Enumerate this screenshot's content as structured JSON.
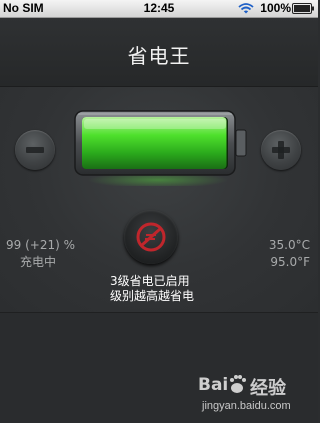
{
  "status_bar": {
    "carrier": "No SIM",
    "time": "12:45",
    "battery_percent": "100%",
    "wifi_icon": "wifi-icon",
    "battery_icon": "battery-full-icon"
  },
  "header": {
    "title": "省电王"
  },
  "battery": {
    "level": 0.99,
    "color": "#39d12a"
  },
  "controls": {
    "decrease_icon": "minus-icon",
    "increase_icon": "plus-icon",
    "power_save_icon": "power-save-icon"
  },
  "stats": {
    "charge_percent": "99 (+21) %",
    "charge_status": "充电中",
    "temp_c": "35.0°C",
    "temp_f": "95.0°F"
  },
  "mode": {
    "line1": "3级省电已启用",
    "line2": "级别越高越省电",
    "accent_color": "#c0262c"
  },
  "watermark": {
    "brand": "经验",
    "url": "jingyan.baidu.com"
  }
}
